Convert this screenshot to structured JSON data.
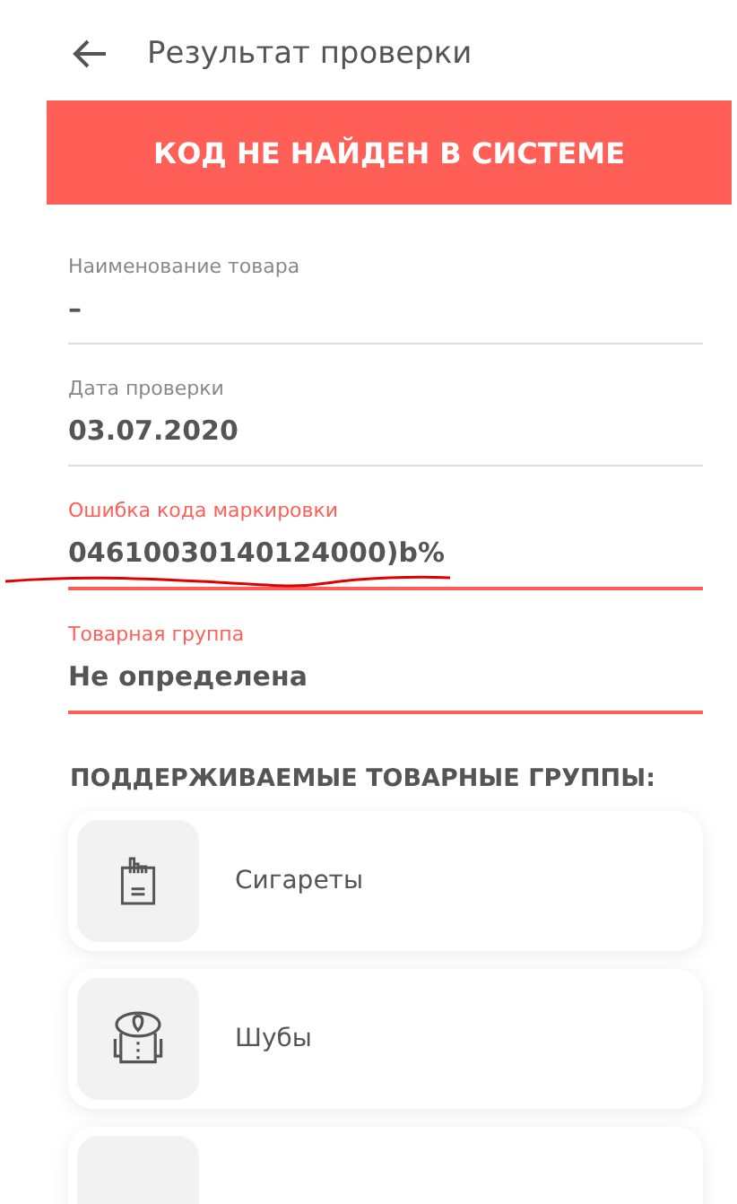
{
  "header": {
    "title": "Результат проверки"
  },
  "banner": {
    "text": "КОД НЕ НАЙДЕН В СИСТЕМЕ"
  },
  "fields": [
    {
      "label": "Наименование товара",
      "value": "–",
      "error": false
    },
    {
      "label": "Дата проверки",
      "value": "03.07.2020",
      "error": false
    },
    {
      "label": "Ошибка кода маркировки",
      "value": "04610030140124000)b%",
      "error": true
    },
    {
      "label": "Товарная группа",
      "value": "Не определена",
      "error": true
    }
  ],
  "groups": {
    "title": "ПОДДЕРЖИВАЕМЫЕ ТОВАРНЫЕ ГРУППЫ:",
    "items": [
      {
        "kind": "cigarettes",
        "label": "Сигареты"
      },
      {
        "kind": "coat",
        "label": "Шубы"
      },
      {
        "kind": "other"
      }
    ]
  }
}
